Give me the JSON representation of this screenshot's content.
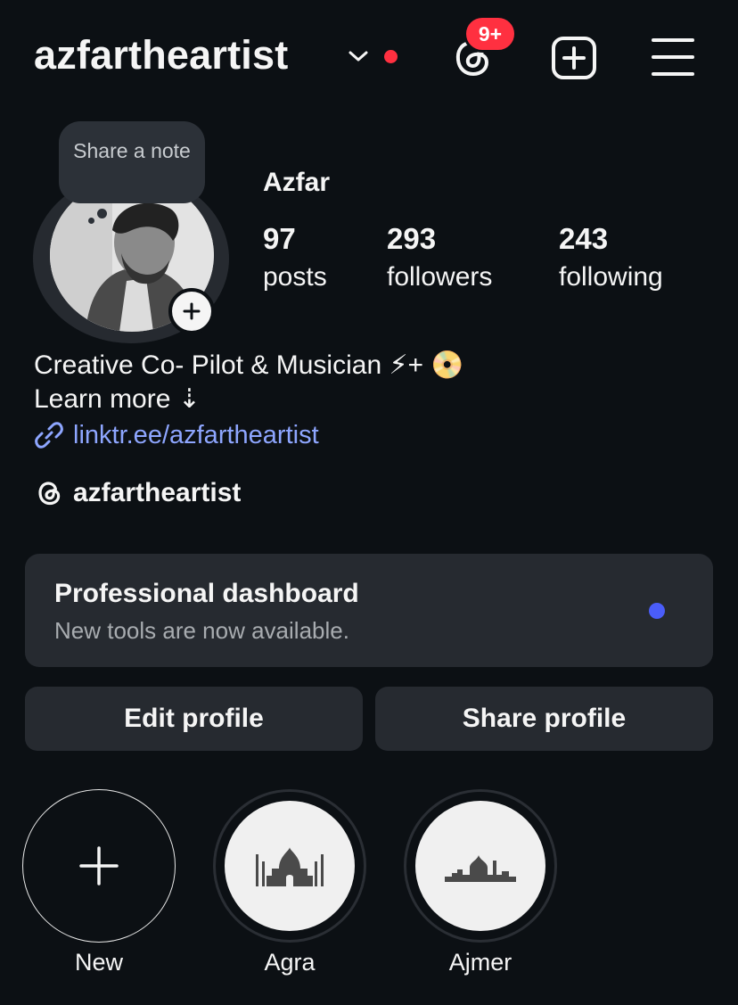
{
  "header": {
    "username": "azfartheartist",
    "notification_badge": "9+"
  },
  "profile": {
    "note_placeholder": "Share a note",
    "display_name": "Azfar",
    "stats": {
      "posts_count": "97",
      "posts_label": "posts",
      "followers_count": "293",
      "followers_label": "followers",
      "following_count": "243",
      "following_label": "following"
    },
    "bio": {
      "line1": "Creative Co- Pilot & Musician ⚡+ 📀",
      "line2": "Learn more ⇣",
      "link": "linktr.ee/azfartheartist",
      "threads_handle": "azfartheartist"
    }
  },
  "dashboard": {
    "title": "Professional dashboard",
    "subtitle": "New tools are now available."
  },
  "actions": {
    "edit_profile": "Edit profile",
    "share_profile": "Share profile"
  },
  "highlights": {
    "new_label": "New",
    "items": [
      {
        "label": "Agra",
        "icon": "taj-mahal-icon"
      },
      {
        "label": "Ajmer",
        "icon": "ajmer-skyline-icon"
      }
    ]
  },
  "colors": {
    "background": "#0c1014",
    "card": "#262a30",
    "badge_red": "#ff3040",
    "link_blue": "#8ea6ff",
    "dash_dot": "#4a5df9"
  }
}
